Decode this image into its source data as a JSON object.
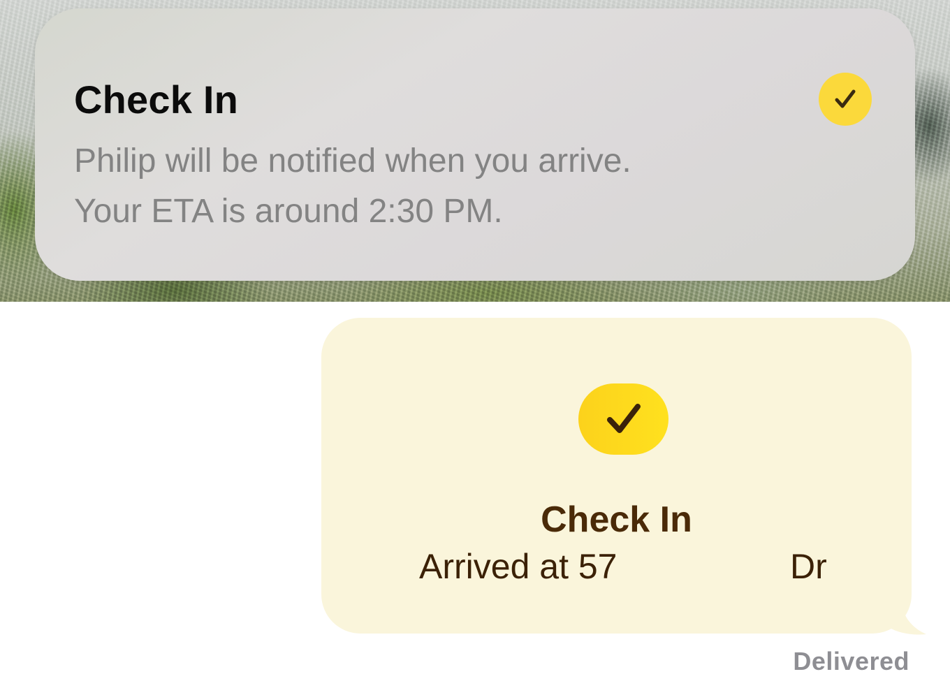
{
  "notification": {
    "title": "Check In",
    "line1": "Philip will be notified when you arrive.",
    "line2": "Your ETA is around 2:30 PM.",
    "icon": "checkmark-icon",
    "icon_color": "#fbd93b"
  },
  "message": {
    "title": "Check In",
    "subtitle_start": "Arrived at 57",
    "subtitle_end": "Dr",
    "icon": "checkmark-icon",
    "bubble_color": "#faf5db",
    "badge_color": "#fdd91d",
    "status": "Delivered"
  }
}
